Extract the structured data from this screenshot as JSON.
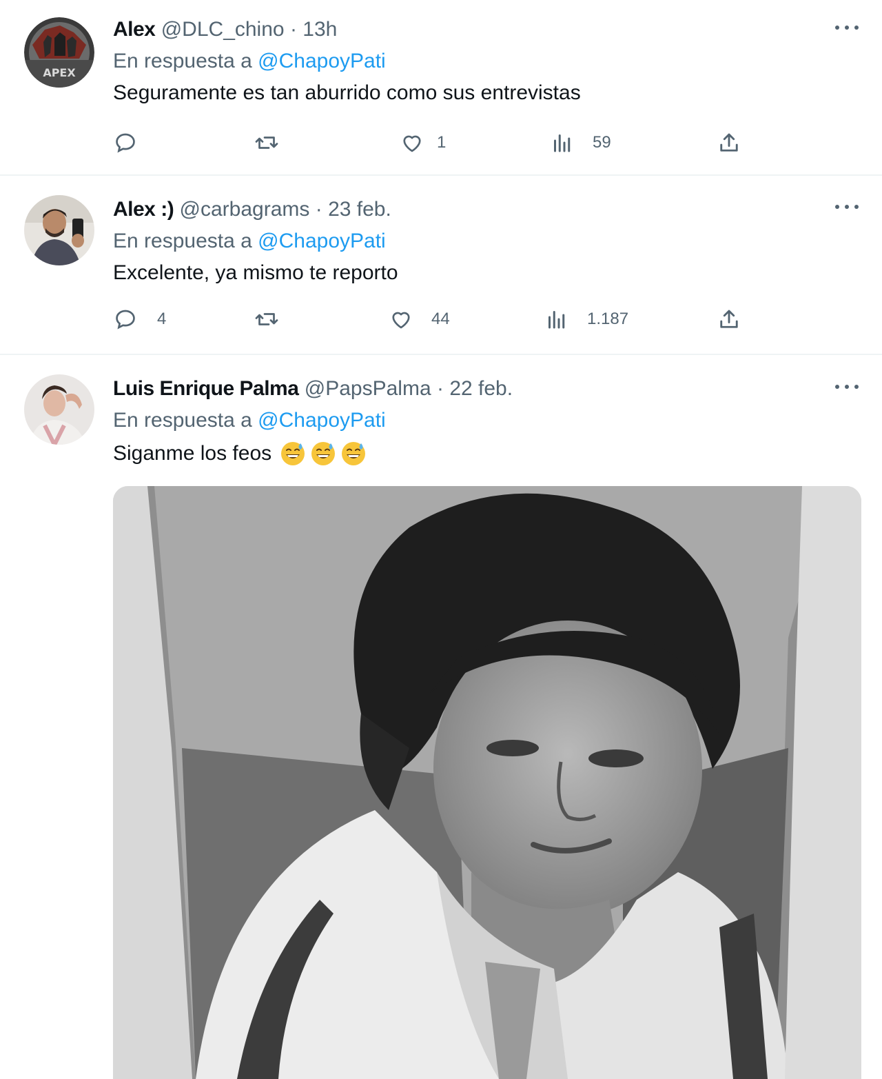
{
  "tweets": [
    {
      "name": "Alex",
      "handle": "@DLC_chino",
      "separator": "·",
      "time": "13h",
      "reply_prefix": "En respuesta a",
      "reply_mention": "@ChapoyPati",
      "text": "Seguramente es tan aburrido como sus entrevistas",
      "avatar_badge": "APEX",
      "replies": "",
      "retweets": "",
      "likes": "1",
      "views": "59"
    },
    {
      "name": "Alex :)",
      "handle": "@carbagrams",
      "separator": "·",
      "time": "23 feb.",
      "reply_prefix": "En respuesta a",
      "reply_mention": "@ChapoyPati",
      "text": "Excelente, ya mismo te reporto",
      "replies": "4",
      "retweets": "",
      "likes": "44",
      "views": "1.187"
    },
    {
      "name": "Luis Enrique Palma",
      "handle": "@PapsPalma",
      "separator": "·",
      "time": "22 feb.",
      "reply_prefix": "En respuesta a",
      "reply_mention": "@ChapoyPati",
      "text": "Siganme los feos",
      "emojis": [
        "grinning-sweat-emoji",
        "grinning-sweat-emoji",
        "grinning-sweat-emoji"
      ]
    }
  ],
  "icons": {
    "reply": "speech-bubble-icon",
    "retweet": "retweet-arrows-icon",
    "like": "heart-outline-icon",
    "views": "bar-chart-icon",
    "share": "upload-arrow-icon",
    "more": "three-dots-icon"
  },
  "colors": {
    "link": "#1d9bf0",
    "secondary_text": "#536471",
    "primary_text": "#0f1419",
    "divider": "#eff3f4"
  }
}
